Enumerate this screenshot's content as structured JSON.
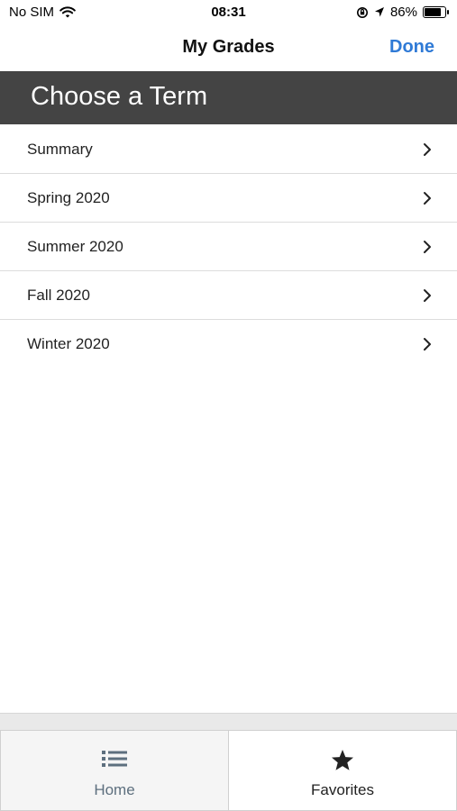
{
  "status_bar": {
    "carrier": "No SIM",
    "time": "08:31",
    "battery_percent": "86%",
    "battery_level": 0.86,
    "icons": [
      "wifi-icon",
      "orientation-lock-icon",
      "location-arrow-icon",
      "battery-icon"
    ]
  },
  "nav": {
    "title": "My Grades",
    "done_label": "Done",
    "accent_color": "#2f7ad6"
  },
  "section": {
    "title": "Choose a Term",
    "background": "#444444"
  },
  "terms": [
    {
      "label": "Summary"
    },
    {
      "label": "Spring 2020"
    },
    {
      "label": "Summer 2020"
    },
    {
      "label": "Fall 2020"
    },
    {
      "label": "Winter 2020"
    }
  ],
  "tab_bar": {
    "tabs": [
      {
        "label": "Home",
        "icon": "list-icon",
        "selected": false
      },
      {
        "label": "Favorites",
        "icon": "star-icon",
        "selected": true
      }
    ]
  }
}
